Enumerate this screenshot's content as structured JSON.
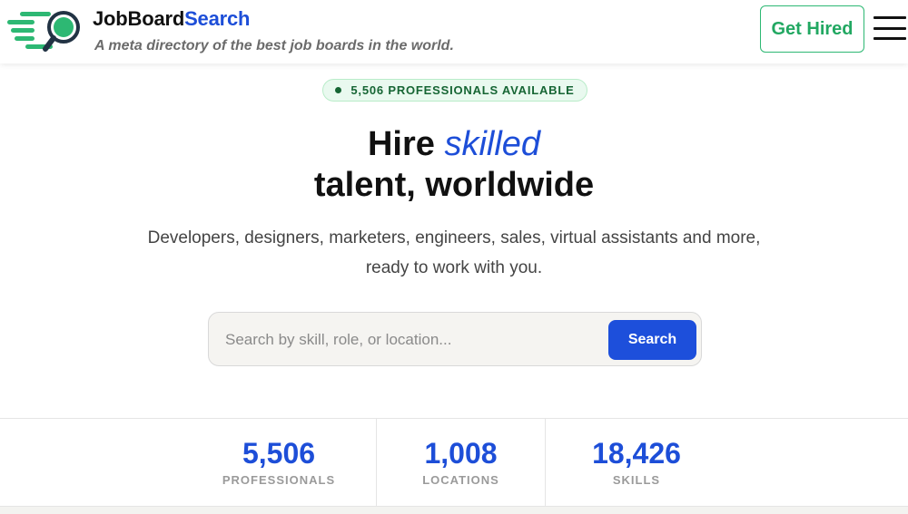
{
  "header": {
    "brand_part1": "JobBoard",
    "brand_part2": "Search",
    "tagline": "A meta directory of the best job boards in the world.",
    "cta_label": "Get Hired",
    "logo_icon": "magnifier-speed-icon",
    "menu_icon": "hamburger-menu-icon"
  },
  "badge": {
    "text": "5,506 PROFESSIONALS AVAILABLE"
  },
  "hero": {
    "title_word1": "Hire",
    "title_emphasis": "skilled",
    "title_line2": "talent, worldwide",
    "subtitle_line1": "Developers, designers, marketers, engineers, sales, virtual assistants and more,",
    "subtitle_line2": "ready to work with you."
  },
  "search": {
    "placeholder": "Search by skill, role, or location...",
    "value": "",
    "button_label": "Search"
  },
  "stats": [
    {
      "value": "5,506",
      "label": "PROFESSIONALS"
    },
    {
      "value": "1,008",
      "label": "LOCATIONS"
    },
    {
      "value": "18,426",
      "label": "SKILLS"
    }
  ],
  "colors": {
    "accent_blue": "#1d4ed8",
    "brand_green": "#2db873",
    "badge_green": "#166534"
  }
}
